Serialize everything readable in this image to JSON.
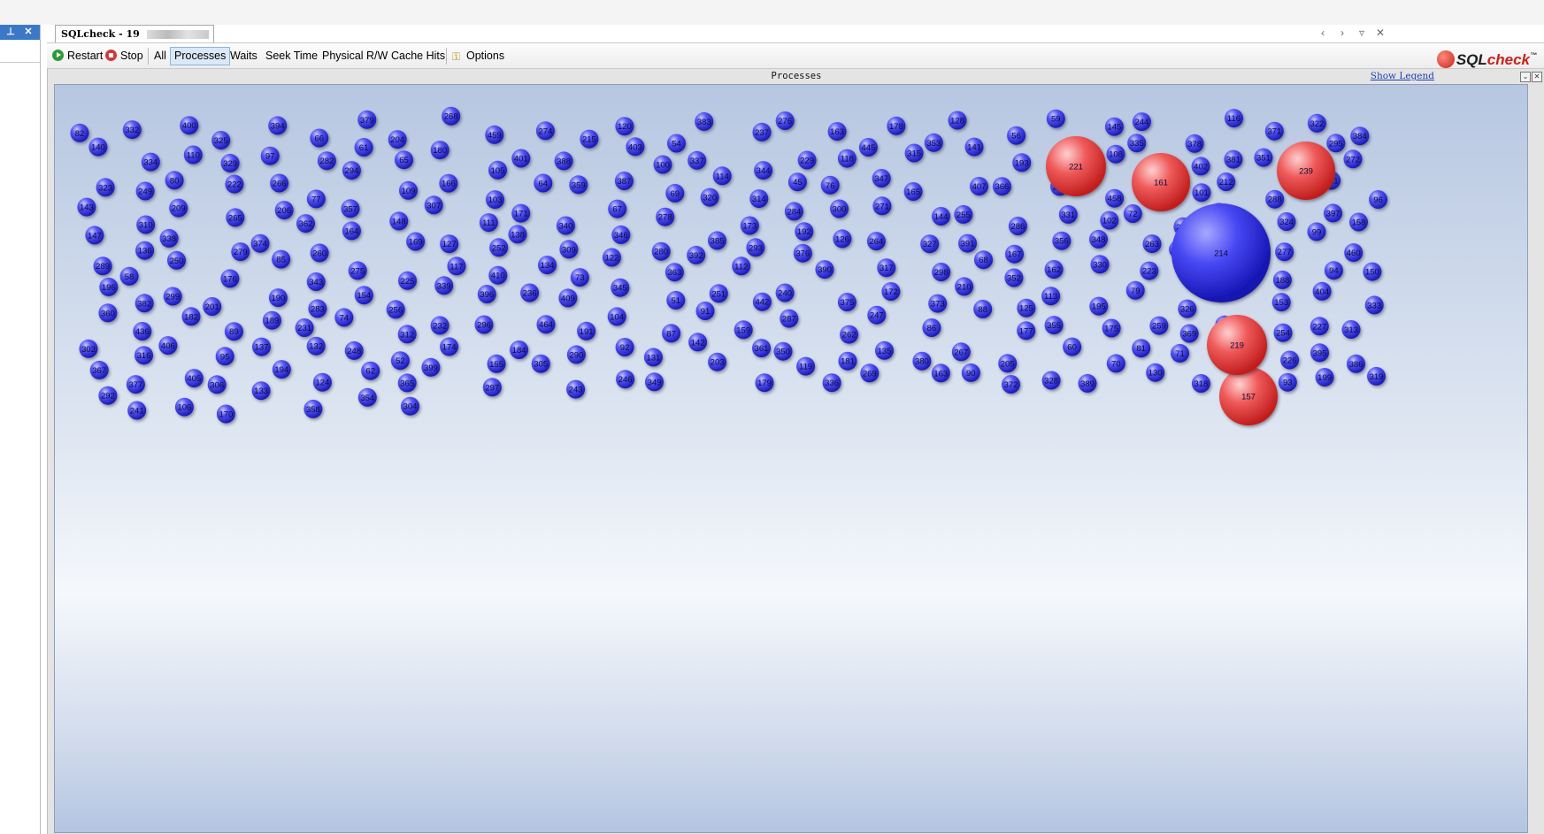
{
  "window": {
    "tab_title": "SQLcheck - 19",
    "left_pane_buttons": [
      "pin-icon",
      "close-icon"
    ],
    "tab_nav": [
      "chevron-left-icon",
      "chevron-right-icon",
      "dropdown-icon",
      "close-icon"
    ]
  },
  "toolbar": {
    "restart": "Restart",
    "stop": "Stop",
    "all": "All",
    "processes": "Processes",
    "waits": "Waits",
    "seek_time": "Seek Time",
    "physical_rw": "Physical R/W",
    "cache_hits": "Cache Hits",
    "options": "Options",
    "selected": "Processes"
  },
  "logo": {
    "sql": "SQL",
    "check": "check",
    "tm": "™"
  },
  "panel": {
    "title": "Processes",
    "legend_link": "Show Legend"
  },
  "colors": {
    "normal_process": "#3d3df0",
    "highlighted_process": "#e83a3a"
  },
  "processes": {
    "small": [
      "82",
      "332",
      "400",
      "325",
      "394",
      "66",
      "379",
      "204",
      "268",
      "459",
      "274",
      "215",
      "120",
      "54",
      "383",
      "237",
      "276",
      "163",
      "178",
      "353",
      "128",
      "56",
      "59",
      "145",
      "244",
      "378",
      "116",
      "371",
      "322",
      "384",
      "140",
      "334",
      "110",
      "329",
      "97",
      "282",
      "61",
      "65",
      "180",
      "105",
      "401",
      "388",
      "403",
      "100",
      "337",
      "344",
      "229",
      "118",
      "445",
      "315",
      "141",
      "193",
      "210",
      "108",
      "335",
      "402",
      "381",
      "351",
      "295",
      "272",
      "323",
      "249",
      "80",
      "222",
      "266",
      "77",
      "294",
      "109",
      "166",
      "103",
      "64",
      "359",
      "387",
      "69",
      "114",
      "314",
      "45",
      "76",
      "347",
      "165",
      "407",
      "366",
      "202",
      "458",
      "408",
      "101",
      "212",
      "288",
      "121",
      "96",
      "143",
      "310",
      "209",
      "265",
      "206",
      "362",
      "357",
      "148",
      "307",
      "111",
      "171",
      "340",
      "67",
      "278",
      "320",
      "173",
      "284",
      "300",
      "271",
      "144",
      "255",
      "286",
      "331",
      "102",
      "72",
      "211",
      "200",
      "324",
      "397",
      "158",
      "147",
      "136",
      "338",
      "279",
      "374",
      "260",
      "164",
      "169",
      "127",
      "252",
      "138",
      "309",
      "346",
      "280",
      "385",
      "293",
      "192",
      "126",
      "264",
      "327",
      "391",
      "167",
      "356",
      "348",
      "263",
      "217",
      "78",
      "277",
      "99",
      "460",
      "289",
      "58",
      "250",
      "176",
      "85",
      "343",
      "275",
      "225",
      "117",
      "410",
      "134",
      "73",
      "122",
      "363",
      "392",
      "112",
      "376",
      "390",
      "317",
      "298",
      "68",
      "352",
      "162",
      "330",
      "223",
      "197",
      "285",
      "188",
      "94",
      "150",
      "196",
      "382",
      "299",
      "201",
      "190",
      "283",
      "154",
      "256",
      "339",
      "396",
      "236",
      "409",
      "345",
      "51",
      "251",
      "442",
      "240",
      "375",
      "172",
      "373",
      "210",
      "125",
      "113",
      "195",
      "79",
      "326",
      "368",
      "153",
      "404",
      "333",
      "360",
      "436",
      "182",
      "89",
      "189",
      "231",
      "74",
      "312",
      "232",
      "296",
      "464",
      "191",
      "104",
      "87",
      "91",
      "159",
      "287",
      "262",
      "247",
      "86",
      "88",
      "177",
      "355",
      "175",
      "259",
      "369",
      "55",
      "254",
      "227",
      "313",
      "302",
      "316",
      "406",
      "95",
      "137",
      "132",
      "248",
      "52",
      "174",
      "155",
      "184",
      "290",
      "92",
      "131",
      "142",
      "361",
      "350",
      "181",
      "135",
      "380",
      "267",
      "205",
      "60",
      "70",
      "81",
      "71",
      "393",
      "226",
      "395",
      "386",
      "367",
      "377",
      "405",
      "306",
      "194",
      "124",
      "62",
      "365",
      "399",
      "297",
      "305",
      "243",
      "246",
      "349",
      "203",
      "179",
      "119",
      "336",
      "269",
      "163",
      "90",
      "372",
      "328",
      "389",
      "130",
      "318",
      "207",
      "93",
      "199",
      "319",
      "292",
      "241",
      "106",
      "170",
      "133",
      "358",
      "354",
      "304",
      "221",
      "161",
      "239",
      "214",
      "219",
      "157"
    ],
    "highlighted": [
      "221",
      "161",
      "239",
      "214",
      "219",
      "157"
    ],
    "large_value": "214"
  }
}
